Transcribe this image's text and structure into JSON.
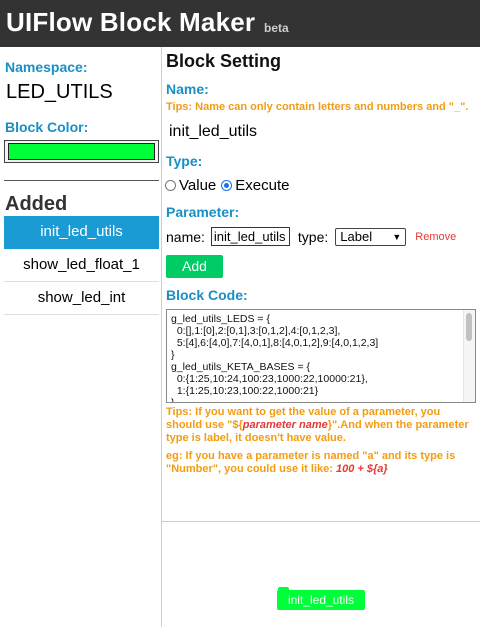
{
  "app": {
    "title": "UIFlow Block Maker",
    "badge": "beta"
  },
  "sidebar": {
    "namespace_label": "Namespace:",
    "namespace_value": "LED_UTILS",
    "block_color_label": "Block Color:",
    "block_color": "#00ff39",
    "added_title": "Added",
    "blocks": [
      {
        "label": "init_led_utils",
        "active": true
      },
      {
        "label": "show_led_float_1",
        "active": false
      },
      {
        "label": "show_led_int",
        "active": false
      }
    ]
  },
  "main": {
    "title": "Block Setting",
    "name_label": "Name:",
    "name_tip": "Tips: Name can only contain letters and numbers and \"_\".",
    "name_value": "init_led_utils",
    "type_label": "Type:",
    "type_options": [
      {
        "label": "Value",
        "checked": false
      },
      {
        "label": "Execute",
        "checked": true
      }
    ],
    "parameter_label": "Parameter:",
    "param_name_label": "name:",
    "param_name_value": "init_led_utils",
    "param_type_label": "type:",
    "param_type_value": "Label",
    "remove_label": "Remove",
    "add_label": "Add",
    "code_label": "Block Code:",
    "code_text": "g_led_utils_LEDS = {\n  0:[],1:[0],2:[0,1],3:[0,1,2],4:[0,1,2,3],\n  5:[4],6:[4,0],7:[4,0,1],8:[4,0,1,2],9:[4,0,1,2,3]\n}\ng_led_utils_KETA_BASES = {\n  0:{1:25,10:24,100:23,1000:22,10000:21},\n  1:{1:25,10:23,100:22,1000:21}\n}",
    "tip1_prefix": "Tips: If you want to get the value of a parameter, you should use \"${",
    "tip1_param": "parameter name",
    "tip1_suffix": "}\".And when the parameter type is label, it doesn't have value.",
    "tip2_text": "eg: If you have a parameter is named \"a\" and its type is \"Number\", you could use it like: ",
    "tip2_example": "100 + ${a}",
    "preview_label": "init_led_utils"
  },
  "colors": {
    "header_bg": "#333333",
    "accent_blue": "#1a9bd4",
    "tip_orange": "#f39c12",
    "add_green": "#00cc66",
    "block_green": "#00ff39",
    "remove_red": "#e53935"
  }
}
